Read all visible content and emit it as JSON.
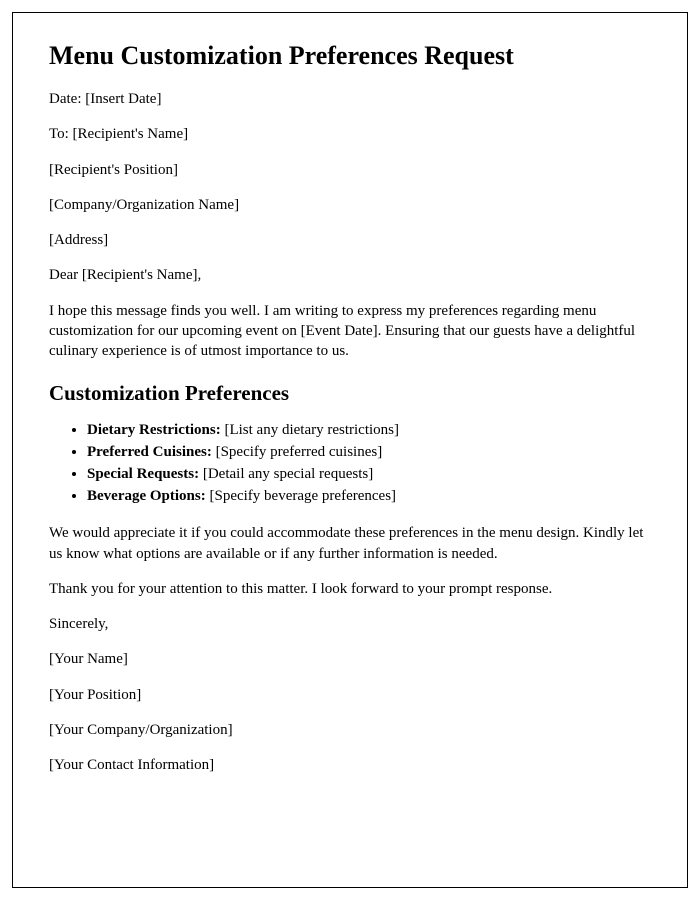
{
  "title": "Menu Customization Preferences Request",
  "header": {
    "date": "Date: [Insert Date]",
    "to": "To: [Recipient's Name]",
    "position": "[Recipient's Position]",
    "company": "[Company/Organization Name]",
    "address": "[Address]"
  },
  "salutation": "Dear [Recipient's Name],",
  "intro": "I hope this message finds you well. I am writing to express my preferences regarding menu customization for our upcoming event on [Event Date]. Ensuring that our guests have a delightful culinary experience is of utmost importance to us.",
  "section_heading": "Customization Preferences",
  "preferences": [
    {
      "label": "Dietary Restrictions:",
      "value": " [List any dietary restrictions]"
    },
    {
      "label": "Preferred Cuisines:",
      "value": " [Specify preferred cuisines]"
    },
    {
      "label": "Special Requests:",
      "value": " [Detail any special requests]"
    },
    {
      "label": "Beverage Options:",
      "value": " [Specify beverage preferences]"
    }
  ],
  "body2": "We would appreciate it if you could accommodate these preferences in the menu design. Kindly let us know what options are available or if any further information is needed.",
  "body3": "Thank you for your attention to this matter. I look forward to your prompt response.",
  "closing": "Sincerely,",
  "signature": {
    "name": "[Your Name]",
    "position": "[Your Position]",
    "company": "[Your Company/Organization]",
    "contact": "[Your Contact Information]"
  }
}
